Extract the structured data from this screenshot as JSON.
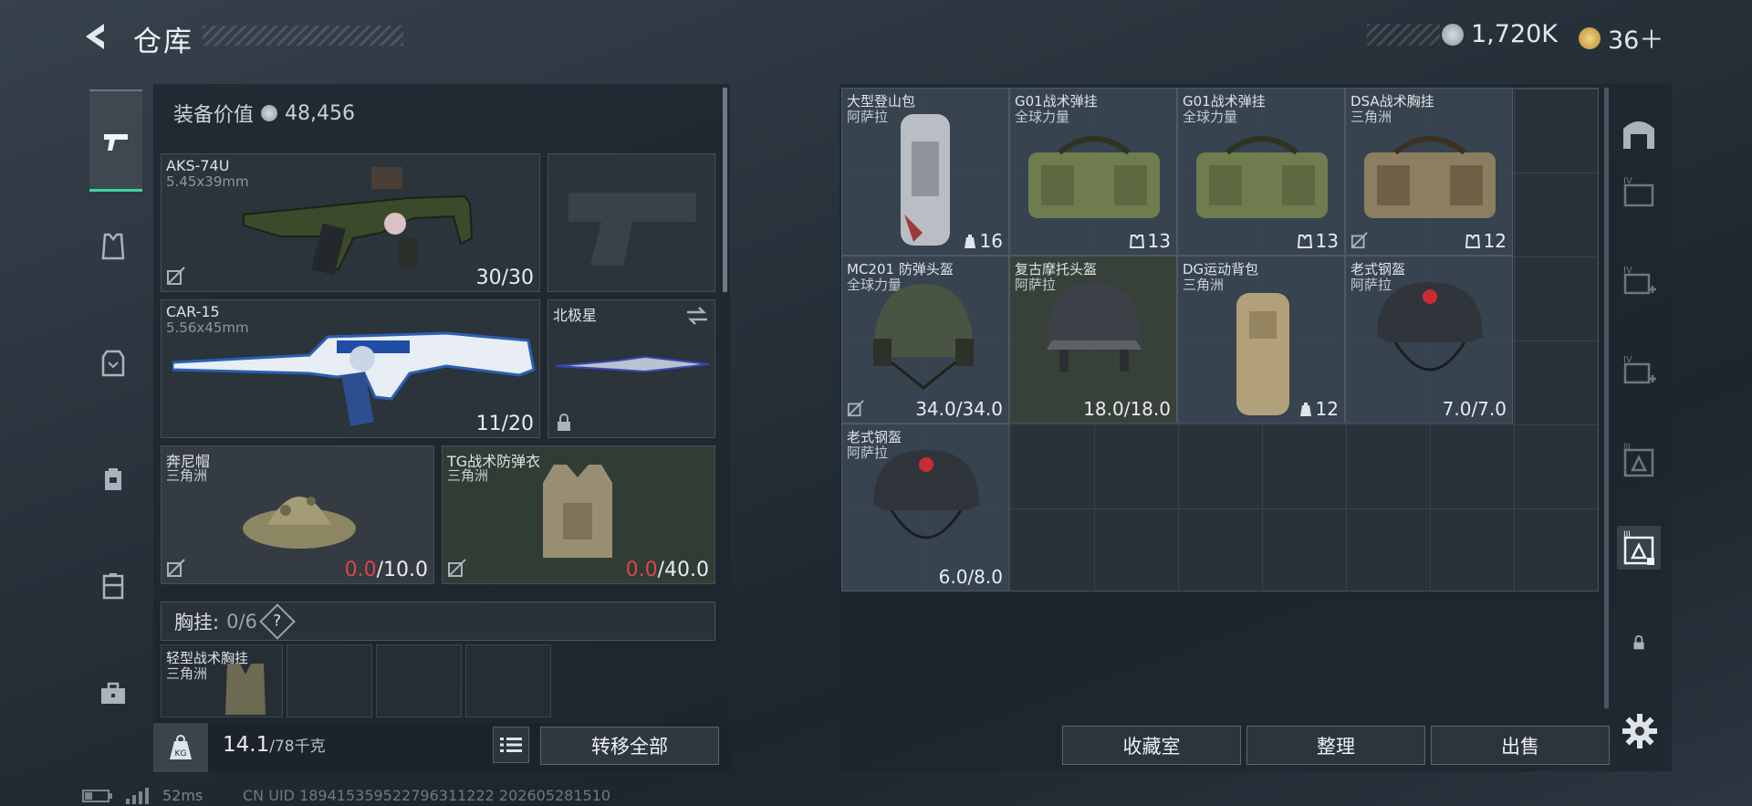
{
  "header": {
    "title": "仓库",
    "currency_1": "1,720K",
    "currency_2": "36＋"
  },
  "nav": {
    "items": [
      "weapon-icon",
      "armor-icon",
      "vest-icon",
      "backpack-icon",
      "case-icon",
      "toolbox-icon"
    ],
    "active": 0
  },
  "loadout": {
    "equipment_value_label": "装备价值",
    "equipment_value": "48,456",
    "primary_weapon": {
      "name": "AKS-74U",
      "caliber": "5.45x39mm",
      "ammo": "30/30"
    },
    "secondary_weapon": {
      "name": "CAR-15",
      "caliber": "5.56x45mm",
      "ammo": "11/20"
    },
    "melee": {
      "name": "北极星"
    },
    "helmet": {
      "name": "奔尼帽",
      "origin": "三角洲",
      "current": "0.0",
      "max": "/10.0"
    },
    "armor": {
      "name": "TG战术防弹衣",
      "origin": "三角洲",
      "current": "0.0",
      "max": "/40.0"
    },
    "chest_rig": {
      "label": "胸挂:",
      "count": "0/6",
      "help": "?"
    },
    "chest_item": {
      "name": "轻型战术胸挂",
      "origin": "三角洲"
    },
    "weight": {
      "current": "14.1",
      "max": "/78千克"
    },
    "kg_label": "KG",
    "transfer_all": "转移全部"
  },
  "stash": {
    "items": [
      {
        "name": "大型登山包",
        "origin": "阿萨拉",
        "value": "16",
        "kind": "backpack"
      },
      {
        "name": "G01战术弹挂",
        "origin": "全球力量",
        "value": "13",
        "kind": "bag"
      },
      {
        "name": "G01战术弹挂",
        "origin": "全球力量",
        "value": "13",
        "kind": "bag"
      },
      {
        "name": "DSA战术胸挂",
        "origin": "三角洲",
        "value": "12",
        "kind": "bag"
      },
      {
        "name": "MC201 防弹头盔",
        "origin": "全球力量",
        "value": "34.0/34.0",
        "kind": "helmet"
      },
      {
        "name": "复古摩托头盔",
        "origin": "阿萨拉",
        "value": "18.0/18.0",
        "kind": "helmet"
      },
      {
        "name": "DG运动背包",
        "origin": "三角洲",
        "value": "12",
        "kind": "backpack"
      },
      {
        "name": "老式钢盔",
        "origin": "阿萨拉",
        "value": "7.0/7.0",
        "kind": "helmet"
      },
      {
        "name": "老式钢盔",
        "origin": "阿萨拉",
        "value": "6.0/8.0",
        "kind": "helmet"
      }
    ],
    "buttons": {
      "collection": "收藏室",
      "sort": "整理",
      "sell": "出售"
    }
  },
  "status": {
    "ping": "52ms",
    "uid": "CN UID 189415359522796311222 202605281510"
  }
}
